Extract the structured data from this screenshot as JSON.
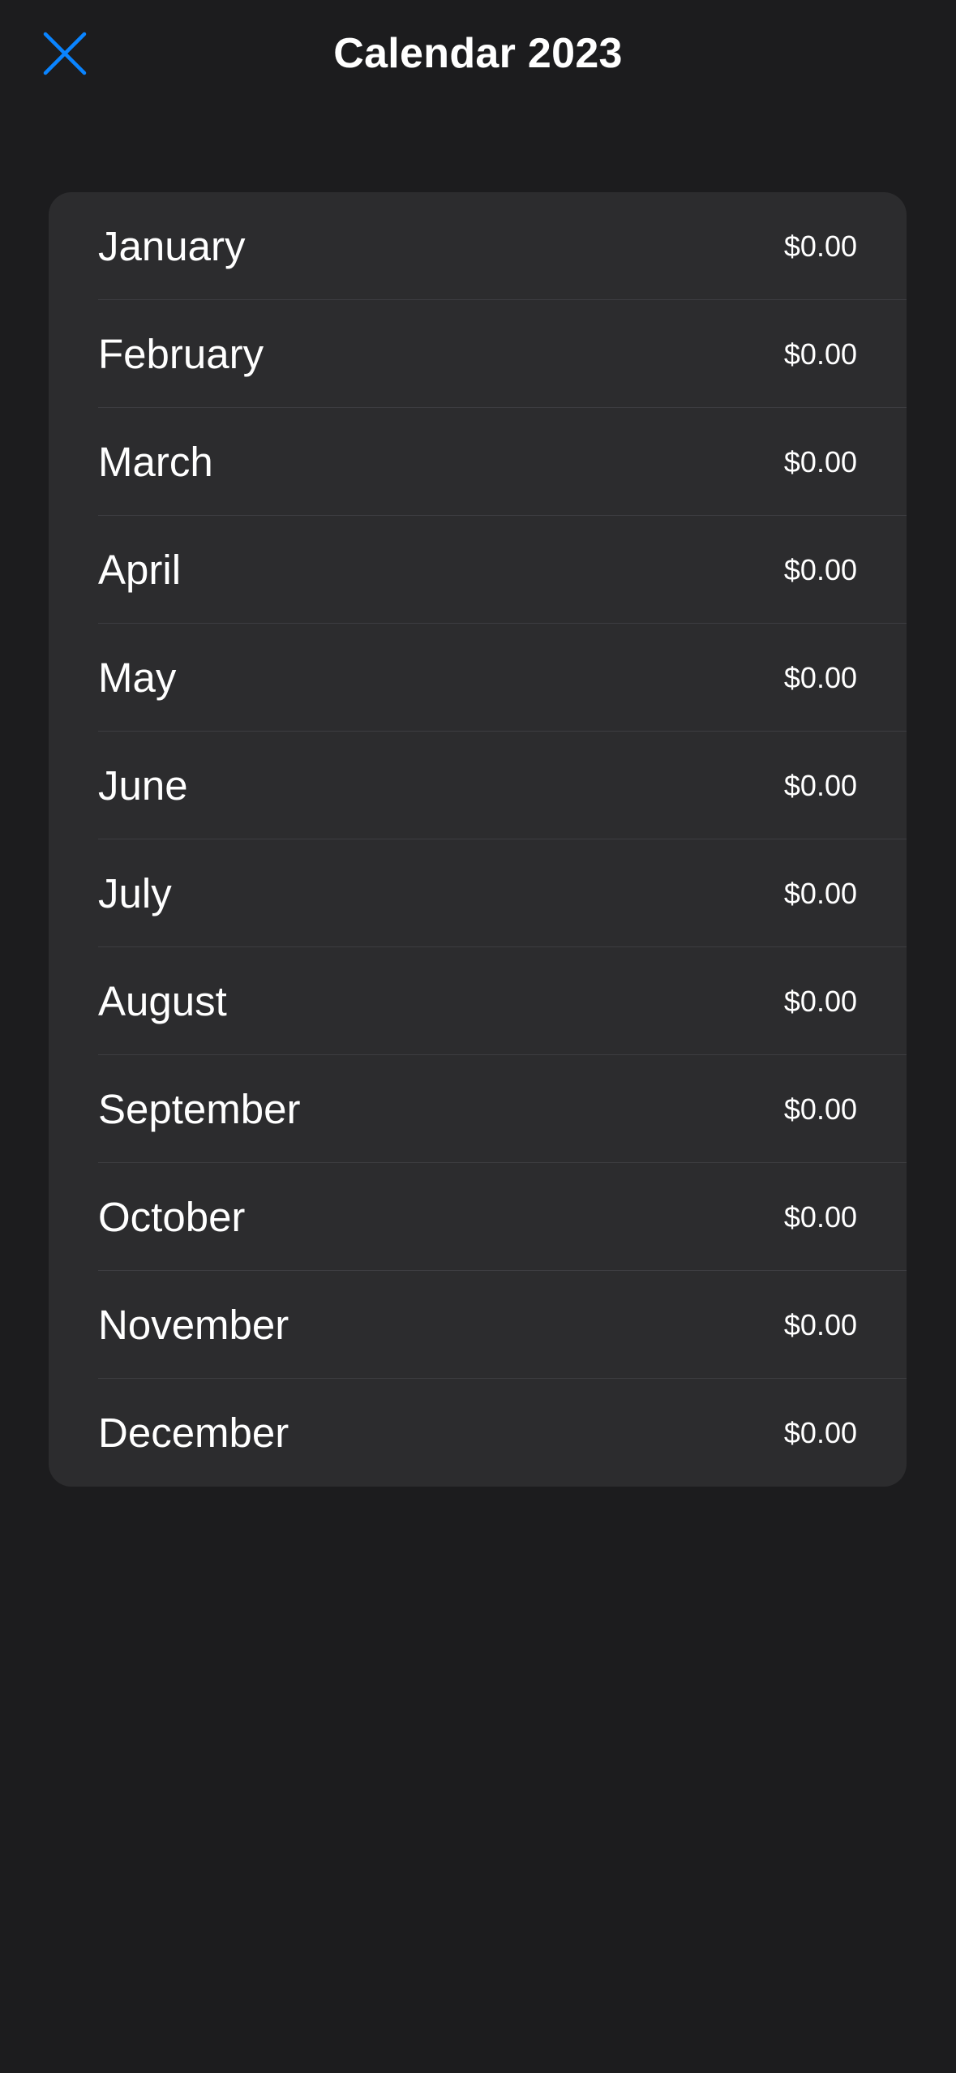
{
  "header": {
    "title": "Calendar 2023",
    "close_icon": "close-x-icon",
    "accent_color": "#0a84ff"
  },
  "months": [
    {
      "name": "January",
      "amount": "$0.00"
    },
    {
      "name": "February",
      "amount": "$0.00"
    },
    {
      "name": "March",
      "amount": "$0.00"
    },
    {
      "name": "April",
      "amount": "$0.00"
    },
    {
      "name": "May",
      "amount": "$0.00"
    },
    {
      "name": "June",
      "amount": "$0.00"
    },
    {
      "name": "July",
      "amount": "$0.00"
    },
    {
      "name": "August",
      "amount": "$0.00"
    },
    {
      "name": "September",
      "amount": "$0.00"
    },
    {
      "name": "October",
      "amount": "$0.00"
    },
    {
      "name": "November",
      "amount": "$0.00"
    },
    {
      "name": "December",
      "amount": "$0.00"
    }
  ],
  "colors": {
    "background": "#1c1c1e",
    "row_background": "#2c2c2e",
    "separator": "#3d3d41",
    "text": "#ffffff"
  }
}
